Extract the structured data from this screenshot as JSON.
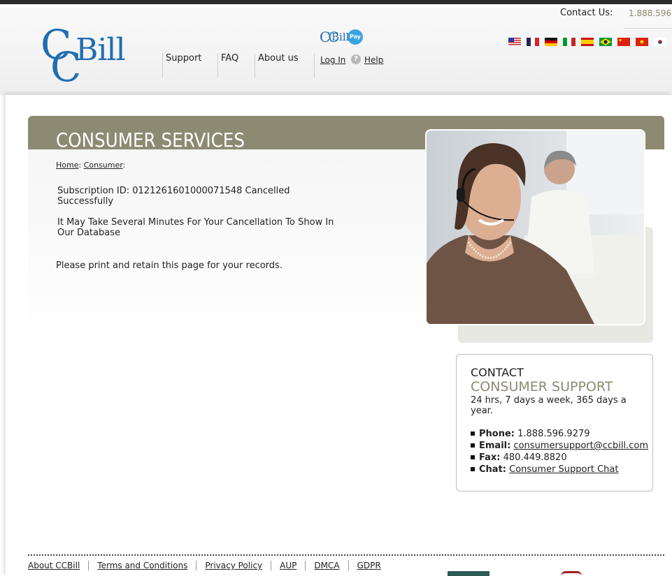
{
  "header": {
    "contact_label": "Contact Us:",
    "contact_phone": "1.888.596.",
    "logo_text": "Bill",
    "pay_logo_badge": "Pay",
    "nav": [
      {
        "label": "Support"
      },
      {
        "label": "FAQ"
      },
      {
        "label": "About us"
      }
    ],
    "login_label": "Log In",
    "help_label": "Help",
    "flags": [
      "us-flag-icon",
      "fr-flag-icon",
      "de-flag-icon",
      "it-flag-icon",
      "es-flag-icon",
      "br-flag-icon",
      "cn-flag-icon",
      "vn-flag-icon",
      "kr-flag-icon"
    ]
  },
  "page": {
    "title": "CONSUMER SERVICES",
    "breadcrumb": {
      "home": "Home",
      "consumer": "Consumer"
    },
    "message1": "Subscription ID: 0121261601000071548 Cancelled Successfully",
    "message2": "It May Take Several Minutes For Your Cancellation To Show In Our Database",
    "message3": "Please print and retain this page for your records."
  },
  "contact_box": {
    "title1": "CONTACT",
    "title2": "CONSUMER SUPPORT",
    "hours": "24 hrs, 7 days a week, 365 days a year.",
    "phone_label": "Phone:",
    "phone_value": "1.888.596.9279",
    "email_label": "Email:",
    "email_value": "consumersupport@ccbill.com",
    "fax_label": "Fax:",
    "fax_value": "480.449.8820",
    "chat_label": "Chat:",
    "chat_value": "Consumer Support Chat"
  },
  "footer": {
    "links": [
      "About CCBill",
      "Terms and Conditions",
      "Privacy Policy",
      "AUP",
      "DMCA",
      "GDPR"
    ]
  },
  "colors": {
    "accent": "#8c8a72",
    "brand_blue": "#1f6db3"
  }
}
